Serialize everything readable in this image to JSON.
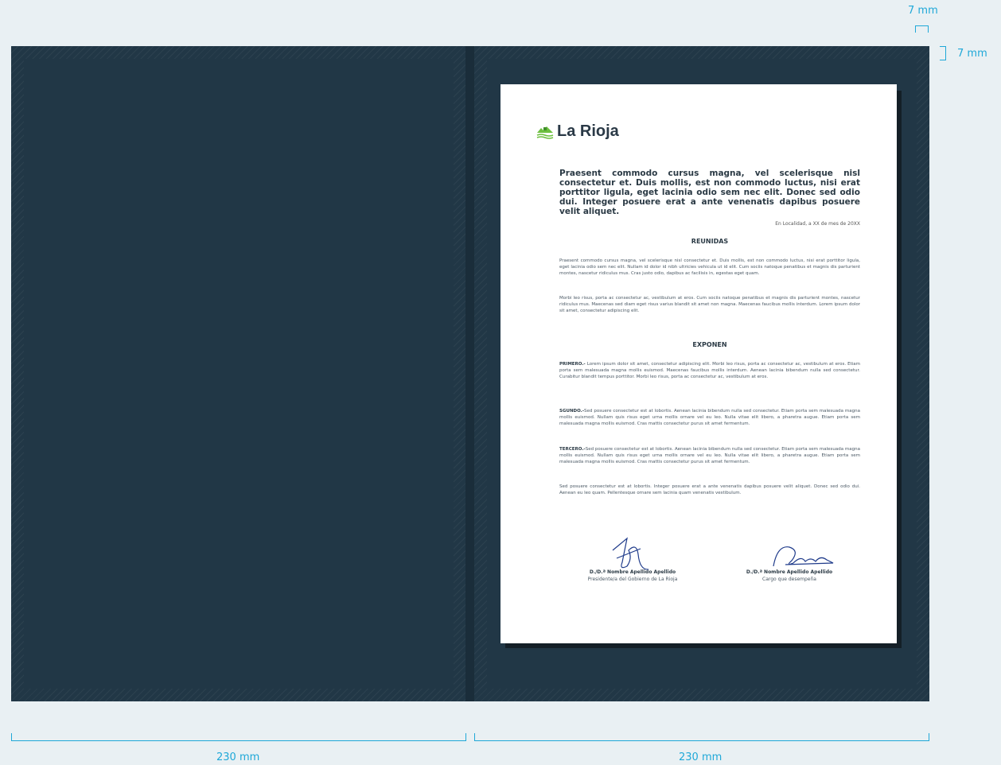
{
  "dimensions": {
    "top_width": "7 mm",
    "top_height": "7 mm",
    "left_panel_width": "230 mm",
    "right_panel_width": "230 mm"
  },
  "document": {
    "logo_text": "La Rioja",
    "headline": "Praesent commodo cursus magna, vel scelerisque nisl consectetur et. Duis mollis, est non commodo luctus, nisi erat porttitor ligula, eget lacinia odio sem nec elit. Donec sed odio dui. Integer posuere erat a ante venenatis dapibus posuere velit aliquet.",
    "date_line": "En Localidad, a XX de mes de 20XX",
    "section1_title": "REUNIDAS",
    "reunidas_p1": "Praesent commodo cursus magna, vel scelerisque nisl consectetur et. Duis mollis, est non commodo luctus, nisi erat porttitor ligula, eget lacinia odio sem nec elit. Nullam id dolor id nibh ultricies vehicula ut id elit. Cum sociis natoque penatibus et magnis dis parturient montes, nascetur ridiculus mus. Cras justo odio, dapibus ac facilisis in, egestas eget quam.",
    "reunidas_p2": "Morbi leo risus, porta ac consectetur ac, vestibulum at eros. Cum sociis natoque penatibus et magnis dis parturient montes, nascetur ridiculus mus. Maecenas sed diam eget risus varius blandit sit amet non magna. Maecenas faucibus mollis interdum. Lorem ipsum dolor sit amet, consectetur adipiscing elit.",
    "section2_title": "EXPONEN",
    "primero_label": "PRIMERO.-",
    "primero_text": " Lorem ipsum dolor sit amet, consectetur adipiscing elit. Morbi leo risus, porta ac consectetur ac, vestibulum at eros. Etiam porta sem malesuada magna mollis euismod. Maecenas faucibus mollis interdum. Aenean lacinia bibendum nulla sed consectetur. Curabitur blandit tempus porttitor. Morbi leo risus, porta ac consectetur ac, vestibulum at eros.",
    "segundo_label": "SGUNDO.-",
    "segundo_text": "Sed posuere consectetur est at lobortis. Aenean lacinia bibendum nulla sed consectetur. Etiam porta sem malesuada magna mollis euismod. Nullam quis risus eget urna mollis ornare vel eu leo. Nulla vitae elit libero, a pharetra augue. Etiam porta sem malesuada magna mollis euismod. Cras mattis consectetur purus sit amet fermentum.",
    "tercero_label": "TERCERO.-",
    "tercero_text": "Sed posuere consectetur est at lobortis. Aenean lacinia bibendum nulla sed consectetur. Etiam porta sem malesuada magna mollis euismod. Nullam quis risus eget urna mollis ornare vel eu leo. Nulla vitae elit libero, a pharetra augue. Etiam porta sem malesuada magna mollis euismod. Cras mattis consectetur purus sit amet fermentum.",
    "closing": "Sed posuere consectetur est at lobortis. Integer posuere erat a ante venenatis dapibus posuere velit aliquet. Donec sed odio dui. Aenean eu leo quam. Pellentesque ornare sem lacinia quam venenatis vestibulum.",
    "signatures": [
      {
        "name": "D./D.ª Nombre Apellido Apellido",
        "role": "Presidente/a del Gobierno de La Rioja"
      },
      {
        "name": "D./D.ª Nombre Apellido Apellido",
        "role": "Cargo que desempeña"
      }
    ]
  },
  "colors": {
    "background": "#e9f0f3",
    "cover": "#213746",
    "dimension_lines": "#1fa8d8",
    "logo_green": "#6dbf3f"
  }
}
